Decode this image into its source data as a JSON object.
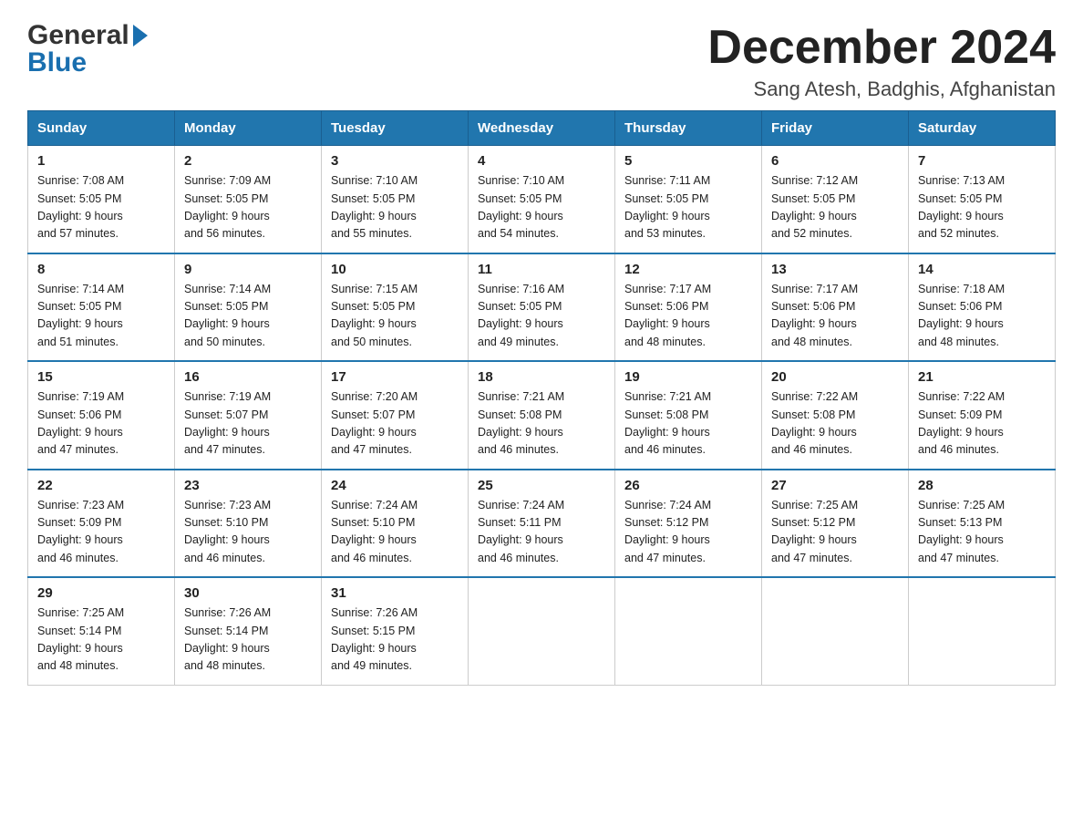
{
  "logo": {
    "general": "General",
    "blue": "Blue"
  },
  "title": "December 2024",
  "subtitle": "Sang Atesh, Badghis, Afghanistan",
  "days": [
    "Sunday",
    "Monday",
    "Tuesday",
    "Wednesday",
    "Thursday",
    "Friday",
    "Saturday"
  ],
  "weeks": [
    [
      {
        "num": "1",
        "sunrise": "7:08 AM",
        "sunset": "5:05 PM",
        "daylight": "9 hours and 57 minutes."
      },
      {
        "num": "2",
        "sunrise": "7:09 AM",
        "sunset": "5:05 PM",
        "daylight": "9 hours and 56 minutes."
      },
      {
        "num": "3",
        "sunrise": "7:10 AM",
        "sunset": "5:05 PM",
        "daylight": "9 hours and 55 minutes."
      },
      {
        "num": "4",
        "sunrise": "7:10 AM",
        "sunset": "5:05 PM",
        "daylight": "9 hours and 54 minutes."
      },
      {
        "num": "5",
        "sunrise": "7:11 AM",
        "sunset": "5:05 PM",
        "daylight": "9 hours and 53 minutes."
      },
      {
        "num": "6",
        "sunrise": "7:12 AM",
        "sunset": "5:05 PM",
        "daylight": "9 hours and 52 minutes."
      },
      {
        "num": "7",
        "sunrise": "7:13 AM",
        "sunset": "5:05 PM",
        "daylight": "9 hours and 52 minutes."
      }
    ],
    [
      {
        "num": "8",
        "sunrise": "7:14 AM",
        "sunset": "5:05 PM",
        "daylight": "9 hours and 51 minutes."
      },
      {
        "num": "9",
        "sunrise": "7:14 AM",
        "sunset": "5:05 PM",
        "daylight": "9 hours and 50 minutes."
      },
      {
        "num": "10",
        "sunrise": "7:15 AM",
        "sunset": "5:05 PM",
        "daylight": "9 hours and 50 minutes."
      },
      {
        "num": "11",
        "sunrise": "7:16 AM",
        "sunset": "5:05 PM",
        "daylight": "9 hours and 49 minutes."
      },
      {
        "num": "12",
        "sunrise": "7:17 AM",
        "sunset": "5:06 PM",
        "daylight": "9 hours and 48 minutes."
      },
      {
        "num": "13",
        "sunrise": "7:17 AM",
        "sunset": "5:06 PM",
        "daylight": "9 hours and 48 minutes."
      },
      {
        "num": "14",
        "sunrise": "7:18 AM",
        "sunset": "5:06 PM",
        "daylight": "9 hours and 48 minutes."
      }
    ],
    [
      {
        "num": "15",
        "sunrise": "7:19 AM",
        "sunset": "5:06 PM",
        "daylight": "9 hours and 47 minutes."
      },
      {
        "num": "16",
        "sunrise": "7:19 AM",
        "sunset": "5:07 PM",
        "daylight": "9 hours and 47 minutes."
      },
      {
        "num": "17",
        "sunrise": "7:20 AM",
        "sunset": "5:07 PM",
        "daylight": "9 hours and 47 minutes."
      },
      {
        "num": "18",
        "sunrise": "7:21 AM",
        "sunset": "5:08 PM",
        "daylight": "9 hours and 46 minutes."
      },
      {
        "num": "19",
        "sunrise": "7:21 AM",
        "sunset": "5:08 PM",
        "daylight": "9 hours and 46 minutes."
      },
      {
        "num": "20",
        "sunrise": "7:22 AM",
        "sunset": "5:08 PM",
        "daylight": "9 hours and 46 minutes."
      },
      {
        "num": "21",
        "sunrise": "7:22 AM",
        "sunset": "5:09 PM",
        "daylight": "9 hours and 46 minutes."
      }
    ],
    [
      {
        "num": "22",
        "sunrise": "7:23 AM",
        "sunset": "5:09 PM",
        "daylight": "9 hours and 46 minutes."
      },
      {
        "num": "23",
        "sunrise": "7:23 AM",
        "sunset": "5:10 PM",
        "daylight": "9 hours and 46 minutes."
      },
      {
        "num": "24",
        "sunrise": "7:24 AM",
        "sunset": "5:10 PM",
        "daylight": "9 hours and 46 minutes."
      },
      {
        "num": "25",
        "sunrise": "7:24 AM",
        "sunset": "5:11 PM",
        "daylight": "9 hours and 46 minutes."
      },
      {
        "num": "26",
        "sunrise": "7:24 AM",
        "sunset": "5:12 PM",
        "daylight": "9 hours and 47 minutes."
      },
      {
        "num": "27",
        "sunrise": "7:25 AM",
        "sunset": "5:12 PM",
        "daylight": "9 hours and 47 minutes."
      },
      {
        "num": "28",
        "sunrise": "7:25 AM",
        "sunset": "5:13 PM",
        "daylight": "9 hours and 47 minutes."
      }
    ],
    [
      {
        "num": "29",
        "sunrise": "7:25 AM",
        "sunset": "5:14 PM",
        "daylight": "9 hours and 48 minutes."
      },
      {
        "num": "30",
        "sunrise": "7:26 AM",
        "sunset": "5:14 PM",
        "daylight": "9 hours and 48 minutes."
      },
      {
        "num": "31",
        "sunrise": "7:26 AM",
        "sunset": "5:15 PM",
        "daylight": "9 hours and 49 minutes."
      },
      null,
      null,
      null,
      null
    ]
  ],
  "labels": {
    "sunrise": "Sunrise:",
    "sunset": "Sunset:",
    "daylight": "Daylight:"
  }
}
